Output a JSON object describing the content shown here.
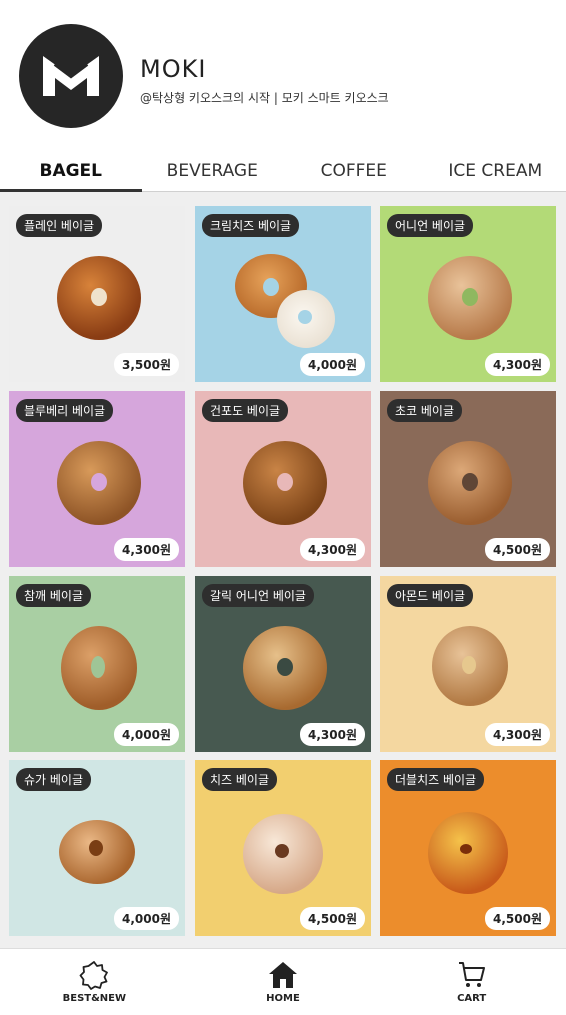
{
  "brand": {
    "name": "MOKI",
    "tagline": "@탁상형 키오스크의 시작  |  모키 스마트 키오스크"
  },
  "tabs": [
    {
      "label": "BAGEL",
      "active": true
    },
    {
      "label": "BEVERAGE",
      "active": false
    },
    {
      "label": "COFFEE",
      "active": false
    },
    {
      "label": "ICE CREAM",
      "active": false
    }
  ],
  "products": [
    {
      "name": "플레인 베이글",
      "price": "3,500원",
      "bg": "#eeeeee"
    },
    {
      "name": "크림치즈 베이글",
      "price": "4,000원",
      "bg": "#a5d3e6"
    },
    {
      "name": "어니언 베이글",
      "price": "4,300원",
      "bg": "#b3da77"
    },
    {
      "name": "블루베리 베이글",
      "price": "4,300원",
      "bg": "#d6a6dc"
    },
    {
      "name": "건포도 베이글",
      "price": "4,300원",
      "bg": "#e8b8b8"
    },
    {
      "name": "초코 베이글",
      "price": "4,500원",
      "bg": "#8a6a58"
    },
    {
      "name": "참깨 베이글",
      "price": "4,000원",
      "bg": "#a9cfa3"
    },
    {
      "name": "갈릭 어니언 베이글",
      "price": "4,300원",
      "bg": "#475950"
    },
    {
      "name": "아몬드 베이글",
      "price": "4,300원",
      "bg": "#f4d7a0"
    },
    {
      "name": "슈가 베이글",
      "price": "4,000원",
      "bg": "#d0e6e4"
    },
    {
      "name": "치즈 베이글",
      "price": "4,500원",
      "bg": "#f2cf6f"
    },
    {
      "name": "더블치즈 베이글",
      "price": "4,500원",
      "bg": "#ec8d2c"
    }
  ],
  "nav": [
    {
      "label": "BEST&NEW",
      "icon": "badge-star-icon"
    },
    {
      "label": "HOME",
      "icon": "home-icon"
    },
    {
      "label": "CART",
      "icon": "cart-icon"
    }
  ]
}
